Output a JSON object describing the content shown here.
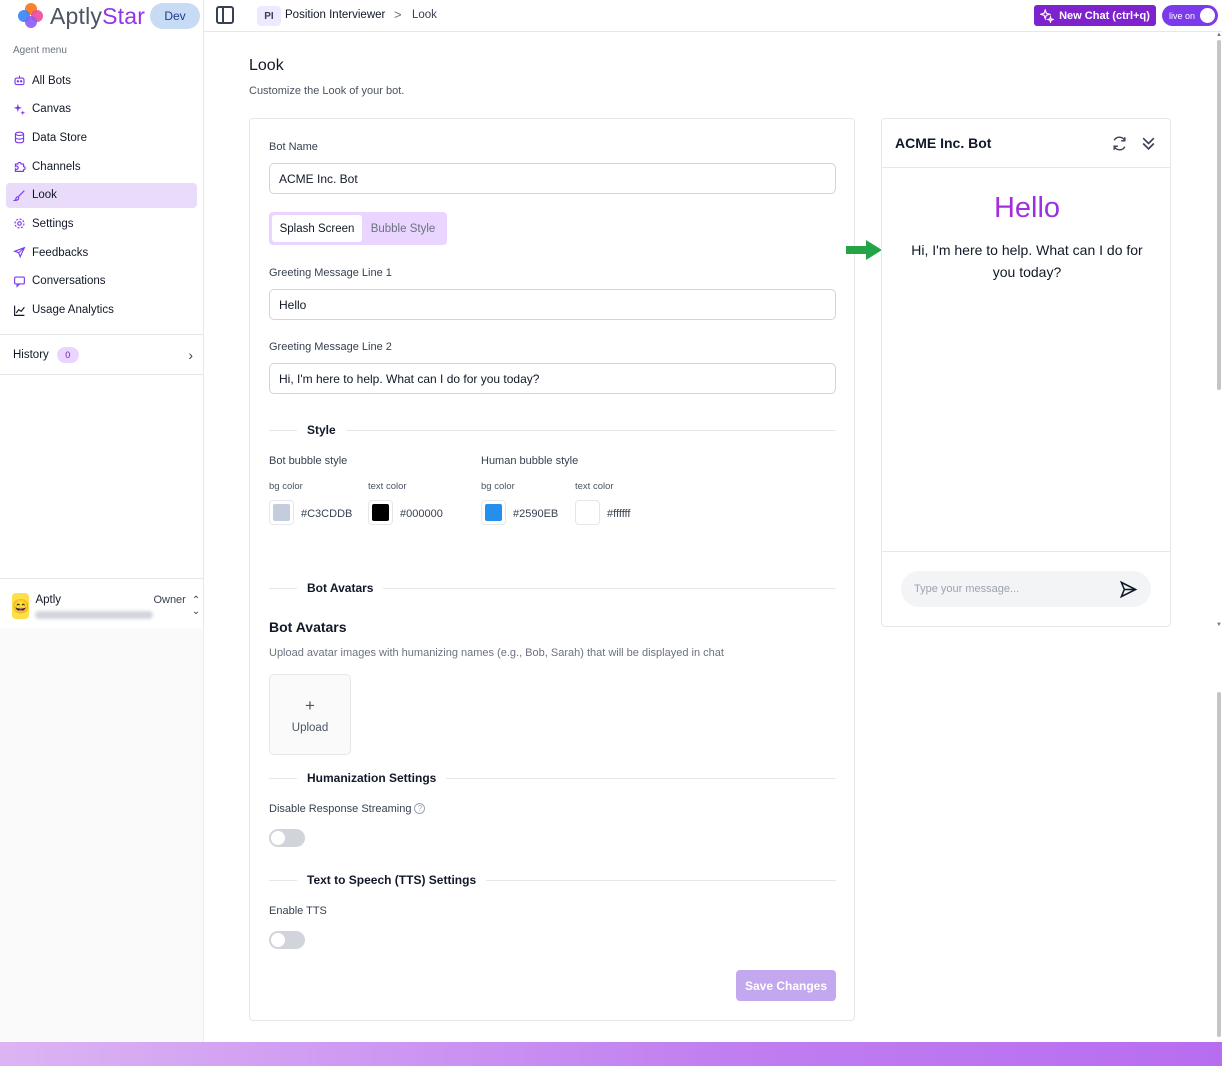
{
  "brand": {
    "name_part1": "Aptly",
    "name_part2": "Star",
    "env_badge": "Dev"
  },
  "sidebar": {
    "menu_label": "Agent menu",
    "items": [
      {
        "label": "All Bots",
        "icon": "bot-icon",
        "active": false
      },
      {
        "label": "Canvas",
        "icon": "sparkles-icon",
        "active": false
      },
      {
        "label": "Data Store",
        "icon": "database-icon",
        "active": false
      },
      {
        "label": "Channels",
        "icon": "puzzle-icon",
        "active": false
      },
      {
        "label": "Look",
        "icon": "brush-icon",
        "active": true
      },
      {
        "label": "Settings",
        "icon": "gear-icon",
        "active": false
      },
      {
        "label": "Feedbacks",
        "icon": "send-icon",
        "active": false
      },
      {
        "label": "Conversations",
        "icon": "chat-icon",
        "active": false
      },
      {
        "label": "Usage Analytics",
        "icon": "line-chart-icon",
        "active": false
      }
    ],
    "history": {
      "label": "History",
      "count": "0"
    },
    "user": {
      "name": "Aptly",
      "role": "Owner"
    }
  },
  "topbar": {
    "crumb_badge": "PI",
    "crumb_parent": "Position Interviewer",
    "crumb_separator": ">",
    "crumb_current": "Look",
    "new_chat_label": "New Chat (ctrl+q)",
    "live_label": "live on"
  },
  "page": {
    "title": "Look",
    "subtitle": "Customize the Look of your bot."
  },
  "form": {
    "bot_name_label": "Bot Name",
    "bot_name_value": "ACME Inc. Bot",
    "tabs": [
      "Splash Screen",
      "Bubble Style"
    ],
    "greeting1_label": "Greeting Message Line 1",
    "greeting1_value": "Hello",
    "greeting2_label": "Greeting Message Line 2",
    "greeting2_value": "Hi, I'm here to help. What can I do for you today?",
    "style_section": "Style",
    "bot_bubble_label": "Bot bubble style",
    "human_bubble_label": "Human bubble style",
    "bg_color_label": "bg color",
    "text_color_label": "text color",
    "bot_bg_color": "#C3CDDB",
    "bot_text_color": "#000000",
    "human_bg_color": "#2590EB",
    "human_text_color": "#ffffff",
    "avatars_section": "Bot Avatars",
    "avatars_title": "Bot Avatars",
    "avatars_desc": "Upload avatar images with humanizing names (e.g., Bob, Sarah) that will be displayed in chat",
    "upload_label": "Upload",
    "upload_plus": "+",
    "humanization_section": "Humanization Settings",
    "disable_streaming_label": "Disable Response Streaming",
    "disable_streaming_on": false,
    "tts_section": "Text to Speech (TTS) Settings",
    "enable_tts_label": "Enable TTS",
    "enable_tts_on": false,
    "save_label": "Save Changes"
  },
  "preview": {
    "title": "ACME Inc. Bot",
    "hello": "Hello",
    "greeting": "Hi, I'm here to help. What can I do for you today?",
    "input_placeholder": "Type your message..."
  },
  "colors": {
    "accent": "#7e22ce",
    "active_nav": "#e9dcfb",
    "arrow": "#22a447"
  }
}
